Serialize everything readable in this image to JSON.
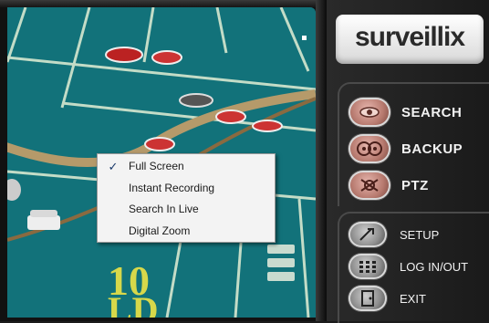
{
  "app": {
    "brand": "surveillix"
  },
  "video": {
    "overlay_text": [
      "10",
      "LD"
    ]
  },
  "context_menu": {
    "items": [
      {
        "label": "Full Screen",
        "checked": true
      },
      {
        "label": "Instant Recording",
        "checked": false
      },
      {
        "label": "Search In Live",
        "checked": false
      },
      {
        "label": "Digital Zoom",
        "checked": false
      }
    ],
    "check_glyph": "✓"
  },
  "nav": {
    "primary": [
      {
        "label": "SEARCH",
        "icon": "eye-icon"
      },
      {
        "label": "BACKUP",
        "icon": "tape-reel-icon"
      },
      {
        "label": "PTZ",
        "icon": "ptz-camera-icon"
      }
    ],
    "secondary": [
      {
        "label": "SETUP",
        "icon": "tools-icon"
      },
      {
        "label": "LOG IN/OUT",
        "icon": "keypad-icon"
      },
      {
        "label": "EXIT",
        "icon": "exit-door-icon"
      }
    ]
  },
  "colors": {
    "felt": "#0f6d74",
    "panel": "#1e1e1e",
    "menu_bg": "#f3f3f3",
    "accent_icon": "#b77a6f"
  }
}
